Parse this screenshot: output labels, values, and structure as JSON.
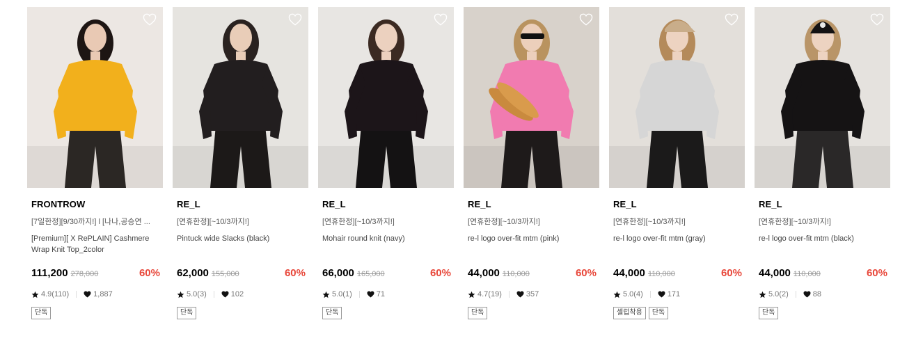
{
  "products": [
    {
      "brand": "FRONTROW",
      "promo": "[7일한정][9/30까지!] l [나나,공승연 ...",
      "name": "[Premium][ X RePLAIN] Cashmere Wrap Knit Top_2color",
      "price": "111,200",
      "original_price": "278,000",
      "discount": "60%",
      "rating": "4.9(110)",
      "likes": "1,887",
      "tags": [
        "단독"
      ],
      "photo": {
        "bg": "#ece7e3",
        "top": "#f2b01c",
        "bottom": "#2b2724",
        "skin": "#e9c9b4",
        "hair": "#1d1513",
        "accessory": "none"
      }
    },
    {
      "brand": "RE_L",
      "promo": "[연휴한정][~10/3까지!]",
      "name": "Pintuck wide Slacks (black)",
      "price": "62,000",
      "original_price": "155,000",
      "discount": "60%",
      "rating": "5.0(3)",
      "likes": "102",
      "tags": [
        "단독"
      ],
      "photo": {
        "bg": "#e6e4e0",
        "top": "#221e1f",
        "bottom": "#1c1918",
        "skin": "#e9cdb8",
        "hair": "#2a2220",
        "accessory": "legs"
      }
    },
    {
      "brand": "RE_L",
      "promo": "[연휴한정][~10/3까지!]",
      "name": "Mohair round knit (navy)",
      "price": "66,000",
      "original_price": "165,000",
      "discount": "60%",
      "rating": "5.0(1)",
      "likes": "71",
      "tags": [
        "단독"
      ],
      "photo": {
        "bg": "#e8e6e3",
        "top": "#1c1519",
        "bottom": "#141213",
        "skin": "#ecd1bf",
        "hair": "#3b2a22",
        "accessory": "none"
      }
    },
    {
      "brand": "RE_L",
      "promo": "[연휴한정][~10/3까지!]",
      "name": "re-l logo over-fit mtm (pink)",
      "price": "44,000",
      "original_price": "110,000",
      "discount": "60%",
      "rating": "4.7(19)",
      "likes": "357",
      "tags": [
        "단독"
      ],
      "photo": {
        "bg": "#d8d2cb",
        "top": "#f17bb0",
        "bottom": "#1e1a1a",
        "skin": "#eccfbb",
        "hair": "#b9935f",
        "accessory": "baguette"
      }
    },
    {
      "brand": "RE_L",
      "promo": "[연휴한정][~10/3까지!]",
      "name": "re-l logo over-fit mtm (gray)",
      "price": "44,000",
      "original_price": "110,000",
      "discount": "60%",
      "rating": "5.0(4)",
      "likes": "171",
      "tags": [
        "셀럽착용",
        "단독"
      ],
      "photo": {
        "bg": "#e3dfda",
        "top": "#d6d6d6",
        "bottom": "#1b1a1a",
        "skin": "#edd3c1",
        "hair": "#b48a5a",
        "accessory": "cap"
      }
    },
    {
      "brand": "RE_L",
      "promo": "[연휴한정][~10/3까지!]",
      "name": "re-l logo over-fit mtm (black)",
      "price": "44,000",
      "original_price": "110,000",
      "discount": "60%",
      "rating": "5.0(2)",
      "likes": "88",
      "tags": [
        "단독"
      ],
      "photo": {
        "bg": "#e5e2de",
        "top": "#151314",
        "bottom": "#2a2828",
        "skin": "#edd3c1",
        "hair": "#b99568",
        "accessory": "beanie"
      }
    }
  ],
  "icons": {
    "wishlist": "heart-outline-icon",
    "rating": "star-icon",
    "likes": "heart-filled-icon"
  },
  "colors": {
    "discount": "#e8473a",
    "text": "#000000",
    "muted": "#777777"
  }
}
